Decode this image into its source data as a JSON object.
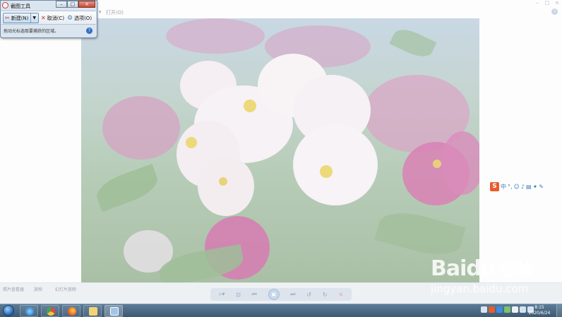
{
  "snipping_tool": {
    "title": "截图工具",
    "new_label": "新建(N)",
    "cancel_label": "取消(C)",
    "options_label": "选项(O)",
    "message": "拖动光标选取要捕获的区域。",
    "help_label": "?"
  },
  "viewer": {
    "menu_open": "打开(O)",
    "help_label": "?",
    "bottom_labels": [
      "照片查看器",
      "放映",
      "幻灯片放映"
    ]
  },
  "ime": {
    "logo": "S",
    "mode_label": "中"
  },
  "watermark": {
    "logo": "Baidu",
    "cn": "经验",
    "url": "jingyan.baidu.com"
  },
  "taskbar": {
    "time": "8:15",
    "date": "2020/6/24"
  },
  "icons": [
    "scissors-icon",
    "dropdown-arrow-icon",
    "cancel-x-icon",
    "options-gear-icon",
    "help-icon",
    "zoom-icon",
    "fit-window-icon",
    "previous-icon",
    "slideshow-play-icon",
    "next-icon",
    "rotate-left-icon",
    "rotate-right-icon",
    "delete-icon",
    "windows-start-orb-icon",
    "ie-browser-icon",
    "chrome-browser-icon",
    "firefox-browser-icon",
    "explorer-folder-icon",
    "photo-viewer-icon"
  ],
  "colors": {
    "accent": "#2f6fc2",
    "ime_orange": "#e85d2b",
    "taskbar": "#4a6985"
  }
}
